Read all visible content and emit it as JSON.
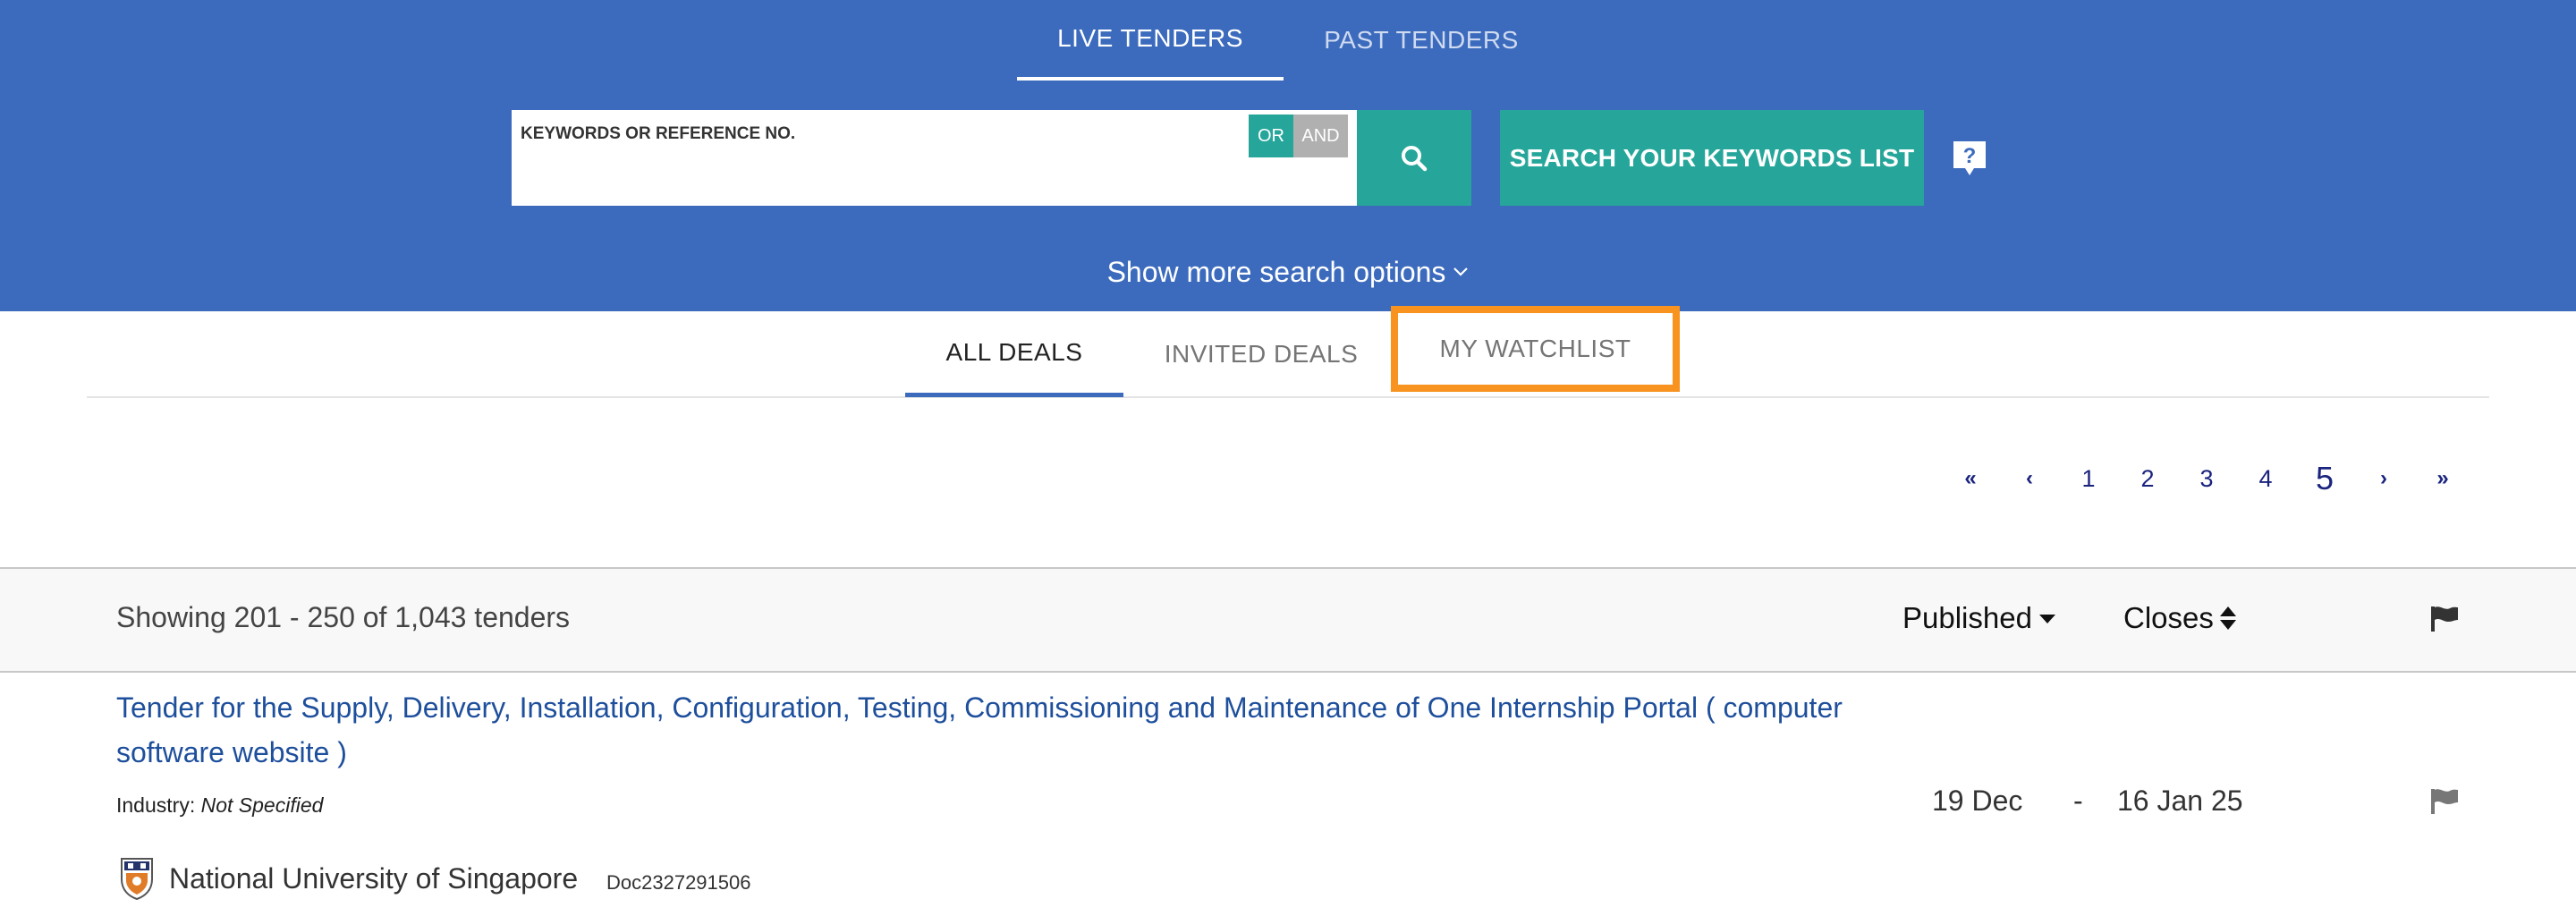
{
  "top_tabs": {
    "live_label": "LIVE TENDERS",
    "past_label": "PAST TENDERS"
  },
  "search": {
    "placeholder": "KEYWORDS OR REFERENCE NO.",
    "value": "",
    "or_label": "OR",
    "and_label": "AND",
    "search_icon": "search-icon",
    "keywords_list_label": "SEARCH YOUR KEYWORDS LIST",
    "help_icon": "question-icon",
    "more_options_label": "Show more search options"
  },
  "deal_tabs": {
    "all_label": "ALL DEALS",
    "invited_label": "INVITED DEALS",
    "watchlist_label": "MY WATCHLIST"
  },
  "pagination": {
    "first": "«",
    "prev": "‹",
    "pages": [
      "1",
      "2",
      "3",
      "4",
      "5"
    ],
    "current": "5",
    "next": "›",
    "last": "»"
  },
  "results": {
    "count_text": "Showing 201 - 250 of 1,043 tenders",
    "sort_published": "Published",
    "sort_closes": "Closes"
  },
  "tender": {
    "title": "Tender for the Supply, Delivery, Installation, Configuration, Testing, Commissioning and Maintenance of One Internship Portal ( computer software website )",
    "industry_label": "Industry:",
    "industry_value": "Not Specified",
    "published": "19 Dec",
    "separator": "-",
    "closes": "16 Jan 25",
    "organization": "National University of Singapore",
    "doc_ref": "Doc2327291506"
  },
  "colors": {
    "header_blue": "#3c6bbd",
    "teal": "#26a69a",
    "highlight_orange": "#f7931e",
    "link_blue": "#1e4f9c",
    "page_link": "#1a237e"
  }
}
